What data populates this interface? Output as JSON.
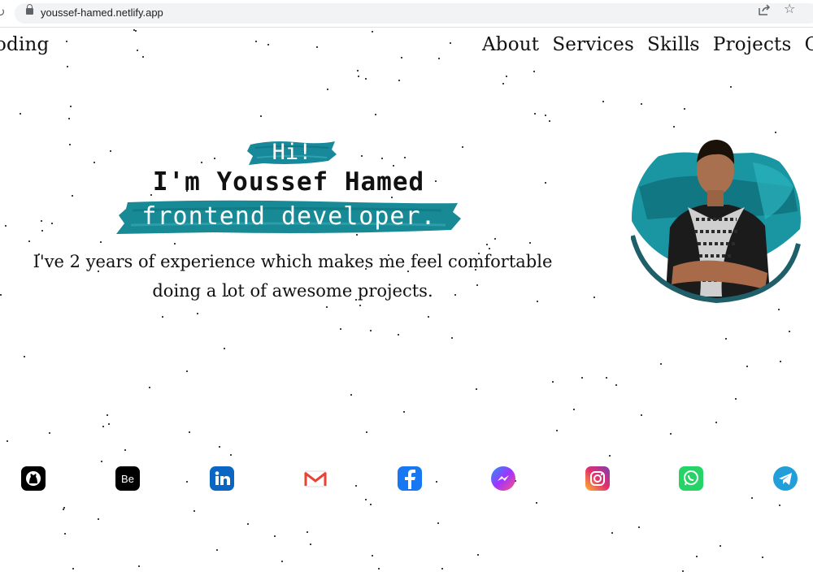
{
  "browser": {
    "url": "youssef-hamed.netlify.app",
    "icons": [
      "reload-icon",
      "lock-icon",
      "share-icon",
      "star-icon"
    ]
  },
  "header": {
    "brand": "oding",
    "nav": [
      {
        "label": "About"
      },
      {
        "label": "Services"
      },
      {
        "label": "Skills"
      },
      {
        "label": "Projects"
      },
      {
        "label": "Cont"
      }
    ]
  },
  "hero": {
    "greeting": "Hi!",
    "name": "I'm Youssef Hamed",
    "role": "frontend developer.",
    "tagline_line1": "I've 2 years of experience which makes me feel comfortable",
    "tagline_line2": "doing a lot of awesome projects."
  },
  "colors": {
    "accent_teal": "#1a8a96",
    "accent_dark": "#0f5f6e",
    "text": "#111111"
  },
  "socials": [
    {
      "name": "github",
      "color": "#000000"
    },
    {
      "name": "behance",
      "color": "#000000"
    },
    {
      "name": "linkedin",
      "color": "#0a66c2"
    },
    {
      "name": "gmail",
      "color": "#ea4335"
    },
    {
      "name": "facebook",
      "color": "#1877f2"
    },
    {
      "name": "messenger",
      "color": "#a033ff"
    },
    {
      "name": "instagram",
      "color": "#e1306c"
    },
    {
      "name": "whatsapp",
      "color": "#25d366"
    },
    {
      "name": "telegram",
      "color": "#229ed9"
    }
  ]
}
